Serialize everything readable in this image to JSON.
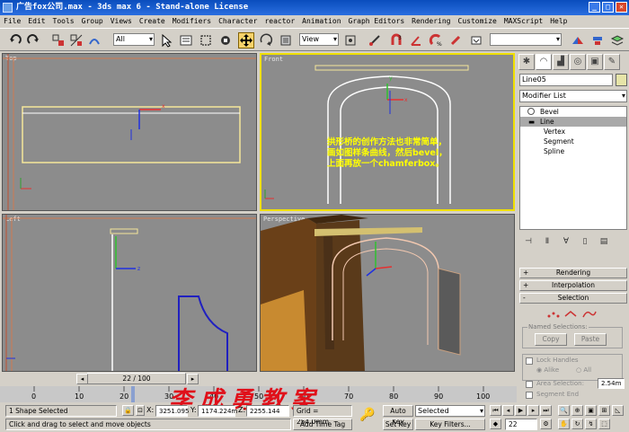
{
  "window": {
    "title": "广告fox公司.max - 3ds max 6 - Stand-alone License"
  },
  "menu": [
    "File",
    "Edit",
    "Tools",
    "Group",
    "Views",
    "Create",
    "Modifiers",
    "Character",
    "reactor",
    "Animation",
    "Graph Editors",
    "Rendering",
    "Customize",
    "MAXScript",
    "Help"
  ],
  "toolbar": {
    "selection_filter": "All",
    "ref_coord": "View",
    "named_selection": ""
  },
  "viewports": {
    "top": "Top",
    "front": "Front",
    "left": "Left",
    "perspective": "Perspective"
  },
  "annotation": {
    "text": "拱形桥的创作方法也非常简单，画如图样条曲线，然后bevel，上面再放一个chamferbox。"
  },
  "command_panel": {
    "object_name": "Line05",
    "modifier_list": "Modifier List",
    "stack": [
      {
        "label": "Bevel",
        "level": 0,
        "selected": false
      },
      {
        "label": "Line",
        "level": 0,
        "selected": true
      },
      {
        "label": "Vertex",
        "level": 1,
        "selected": false
      },
      {
        "label": "Segment",
        "level": 1,
        "selected": false
      },
      {
        "label": "Spline",
        "level": 1,
        "selected": false
      }
    ],
    "rollouts": {
      "rendering": "Rendering",
      "interpolation": "Interpolation",
      "selection": "Selection",
      "plus": "+",
      "minus": "-"
    },
    "named_selections": {
      "title": "Named Selections:",
      "copy": "Copy",
      "paste": "Paste"
    },
    "lock_handles": "Lock Handles",
    "alike": "Alike",
    "all": "All",
    "area_selection": "Area Selection:",
    "area_value": "2.54m",
    "segment_end": "Segment End"
  },
  "timeline": {
    "slider": "22 / 100",
    "ticks": [
      "0",
      "10",
      "20",
      "30",
      "40",
      "50",
      "60",
      "70",
      "80",
      "90",
      "100"
    ]
  },
  "status": {
    "shape_selected": "1 Shape Selected",
    "prompt": "Click and drag to select and move objects",
    "x_label": "X:",
    "x": "3251.095",
    "y_label": "Y:",
    "y": "1174.224m",
    "z_label": "Z:",
    "z": "2255.144",
    "grid": "Grid = 254.0mm",
    "add_time_tag": "Add Time Tag",
    "auto_key": "Auto Key",
    "set_key": "Set Key",
    "key_mode": "Selected",
    "key_filters": "Key Filters...",
    "frame": "22"
  },
  "watermark": "李成勇教案"
}
